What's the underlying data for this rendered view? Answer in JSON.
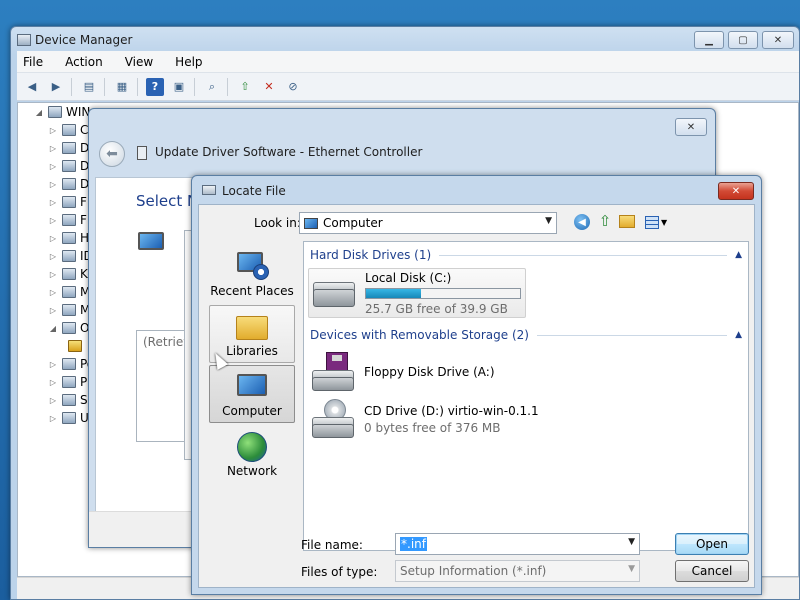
{
  "device_manager": {
    "title": "Device Manager",
    "menu": [
      "File",
      "Action",
      "View",
      "Help"
    ],
    "tree": {
      "root": "WIN-",
      "items": [
        "Co",
        "Di",
        "Di",
        "DV",
        "Fl",
        "Fl",
        "Hu",
        "ID",
        "Ke",
        "Mi",
        "Mo",
        "Ot",
        "",
        "Po",
        "Pr",
        "Sy",
        "Un"
      ]
    }
  },
  "wizard": {
    "title": "Update Driver Software - Ethernet Controller",
    "heading": "Select N",
    "retrieving": "(Retrievi"
  },
  "locate_file": {
    "title": "Locate File",
    "look_in_label": "Look in:",
    "look_in_value": "Computer",
    "places": [
      {
        "label": "Recent Places",
        "icon": "recent-places-icon"
      },
      {
        "label": "Libraries",
        "icon": "libraries-icon"
      },
      {
        "label": "Computer",
        "icon": "computer-icon"
      },
      {
        "label": "Network",
        "icon": "network-icon"
      }
    ],
    "groups": {
      "hdd": "Hard Disk Drives (1)",
      "removable": "Devices with Removable Storage (2)"
    },
    "drives": {
      "local": {
        "name": "Local Disk (C:)",
        "free": "25.7 GB free of 39.9 GB",
        "used_fraction": 0.356
      },
      "floppy": {
        "name": "Floppy Disk Drive (A:)"
      },
      "cd": {
        "name": "CD Drive (D:) virtio-win-0.1.1",
        "free": "0 bytes free of 376 MB"
      }
    },
    "file_name_label": "File name:",
    "file_name_value": "*.inf",
    "files_of_type_label": "Files of type:",
    "files_of_type_value": "Setup Information (*.inf)",
    "open_label": "Open",
    "cancel_label": "Cancel"
  }
}
